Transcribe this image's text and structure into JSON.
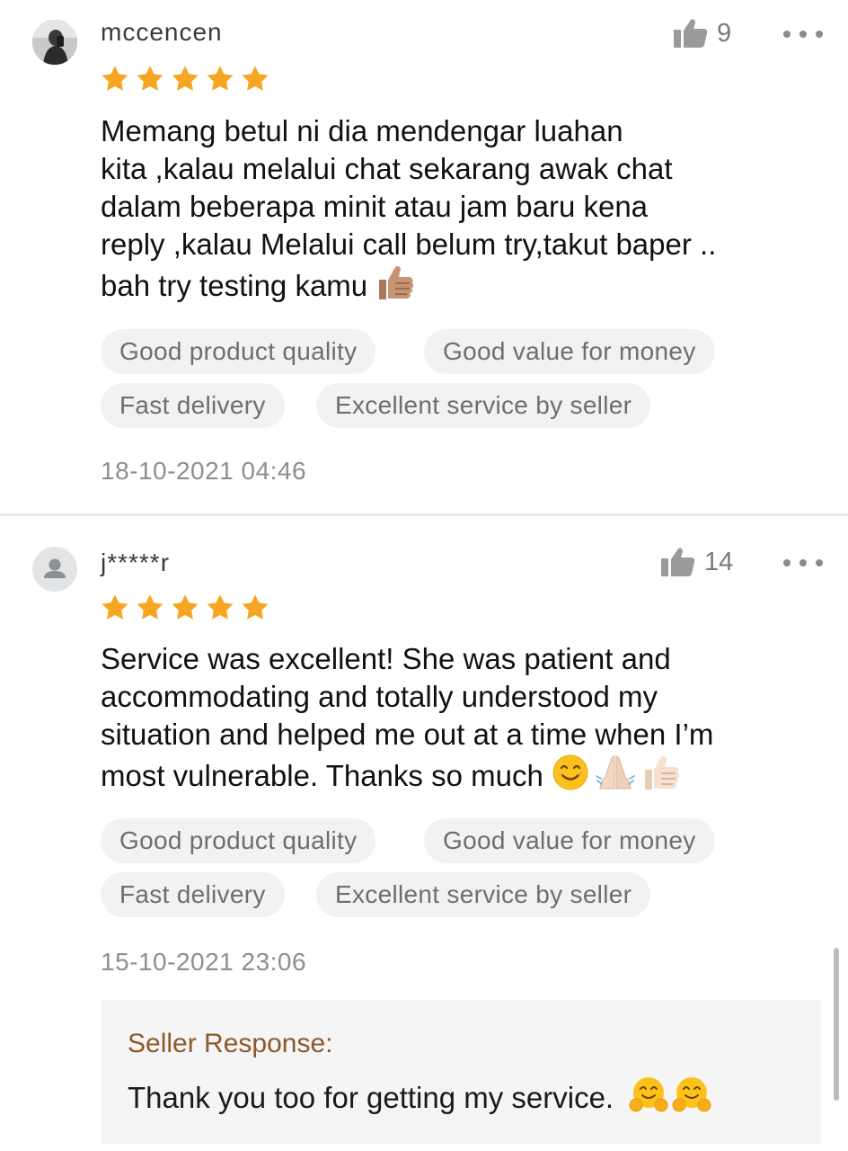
{
  "reviews": [
    {
      "username": "mccencen",
      "avatar_icon": "user-photo-avatar",
      "likes": "9",
      "rating": 5,
      "text_lines": [
        "Memang betul ni dia mendengar luahan",
        "kita ,kalau melalui chat sekarang awak chat",
        "dalam beberapa minit atau jam baru kena",
        "reply ,kalau Melalui call belum try,takut baper ..",
        "bah try testing kamu"
      ],
      "emojis": [
        "thumbs-up-medium-skin"
      ],
      "tags": [
        "Good product quality",
        "Good value for money",
        "Fast delivery",
        "Excellent service by seller"
      ],
      "timestamp": "18-10-2021 04:46"
    },
    {
      "username": "j*****r",
      "avatar_icon": "default-user-avatar",
      "likes": "14",
      "rating": 5,
      "text_lines": [
        "Service was excellent! She was patient and",
        "accommodating and totally understood my",
        "situation and helped me out at a time when I’m",
        "most vulnerable. Thanks so much"
      ],
      "emojis": [
        "smiling-face",
        "folded-hands-light",
        "thumbs-up-light"
      ],
      "tags": [
        "Good product quality",
        "Good value for money",
        "Fast delivery",
        "Excellent service by seller"
      ],
      "timestamp": "15-10-2021 23:06",
      "seller_response": {
        "label": "Seller Response:",
        "text": "Thank you too for getting my service.",
        "emojis": [
          "hugging-face",
          "hugging-face"
        ]
      }
    }
  ],
  "colors": {
    "star": "#f6a623",
    "tag_background": "#f2f2f2",
    "seller_label": "#8b5a2b",
    "seller_background": "#f5f5f5"
  }
}
